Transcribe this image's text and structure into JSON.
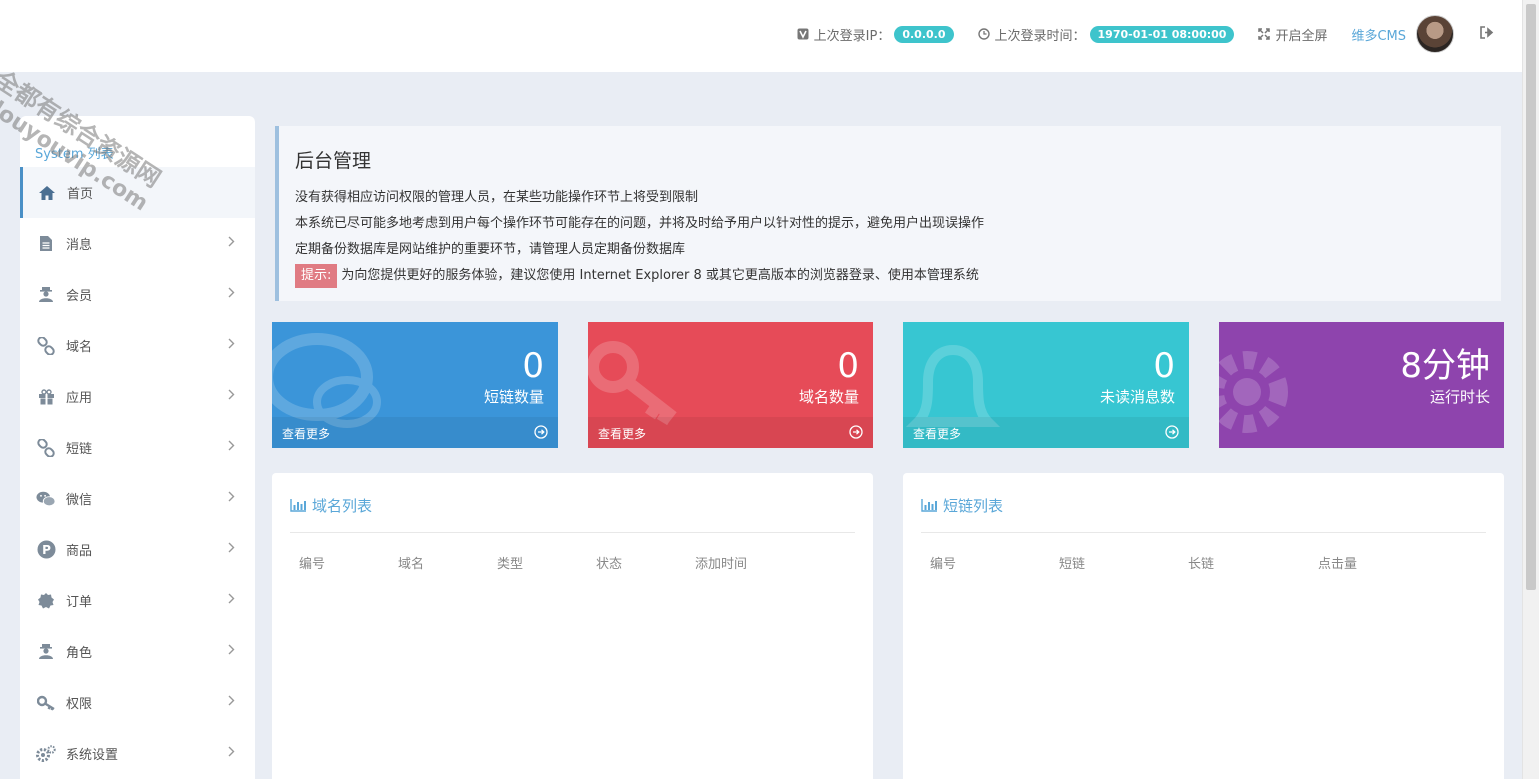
{
  "watermark": {
    "line1": "全都有综合资源网",
    "line2": "douyouvip.com"
  },
  "header": {
    "last_ip_label": "上次登录IP：",
    "last_ip": "0.0.0.0",
    "last_time_label": "上次登录时间：",
    "last_time": "1970-01-01 08:00:00",
    "fullscreen": "开启全屏",
    "brand": "维多CMS"
  },
  "sidebar": {
    "title": "System 列表",
    "items": [
      {
        "label": "首页",
        "icon": "home-icon"
      },
      {
        "label": "消息",
        "icon": "document-icon"
      },
      {
        "label": "会员",
        "icon": "user-icon"
      },
      {
        "label": "域名",
        "icon": "link-icon"
      },
      {
        "label": "应用",
        "icon": "gift-icon"
      },
      {
        "label": "短链",
        "icon": "link-icon"
      },
      {
        "label": "微信",
        "icon": "wechat-icon"
      },
      {
        "label": "商品",
        "icon": "product-icon"
      },
      {
        "label": "订单",
        "icon": "order-icon"
      },
      {
        "label": "角色",
        "icon": "user-icon"
      },
      {
        "label": "权限",
        "icon": "key-icon"
      },
      {
        "label": "系统设置",
        "icon": "gear-icon"
      }
    ]
  },
  "notice": {
    "title": "后台管理",
    "lines": [
      "没有获得相应访问权限的管理人员，在某些功能操作环节上将受到限制",
      "本系统已尽可能多地考虑到用户每个操作环节可能存在的问题，并将及时给予用户以针对性的提示，避免用户出现误操作",
      "定期备份数据库是网站维护的重要环节，请管理人员定期备份数据库"
    ],
    "tip_label": "提示:",
    "tip_text": "为向您提供更好的服务体验，建议您使用 Internet Explorer 8 或其它更高版本的浏览器登录、使用本管理系统"
  },
  "cards": [
    {
      "value": "0",
      "label": "短链数量",
      "more": "查看更多",
      "color": "#3b95d9"
    },
    {
      "value": "0",
      "label": "域名数量",
      "more": "查看更多",
      "color": "#e64b58"
    },
    {
      "value": "0",
      "label": "未读消息数",
      "more": "查看更多",
      "color": "#37c6d2"
    },
    {
      "value": "8分钟",
      "label": "运行时长",
      "color": "#8e44ad"
    }
  ],
  "domain_panel": {
    "title": "域名列表",
    "columns": [
      "编号",
      "域名",
      "类型",
      "状态",
      "添加时间"
    ]
  },
  "link_panel": {
    "title": "短链列表",
    "columns": [
      "编号",
      "短链",
      "长链",
      "点击量"
    ]
  }
}
